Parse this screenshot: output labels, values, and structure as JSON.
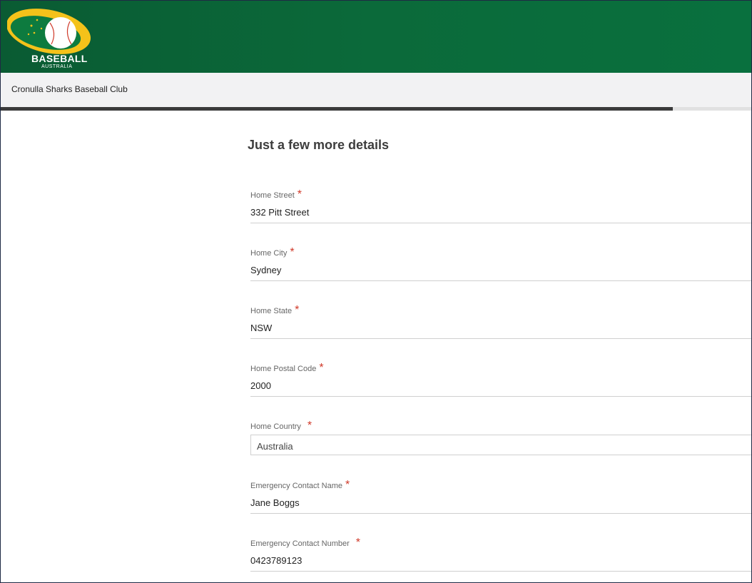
{
  "header": {
    "logo_text": "BASEBALL",
    "logo_subtext": "AUSTRALIA",
    "brand_colors": {
      "green": "#0b6a3a",
      "gold": "#f4c21a"
    }
  },
  "club": {
    "name": "Cronulla Sharks Baseball Club"
  },
  "progress": {
    "percent": 89.5
  },
  "form": {
    "title": "Just a few more details",
    "required_marker": "*",
    "fields": [
      {
        "label": "Home Street",
        "value": "332 Pitt Street",
        "type": "text"
      },
      {
        "label": "Home City",
        "value": "Sydney",
        "type": "text"
      },
      {
        "label": "Home State",
        "value": "NSW",
        "type": "text"
      },
      {
        "label": "Home Postal Code",
        "value": "2000",
        "type": "text"
      },
      {
        "label": "Home Country",
        "value": "Australia",
        "type": "select"
      },
      {
        "label": "Emergency Contact Name",
        "value": "Jane Boggs",
        "type": "text"
      },
      {
        "label": "Emergency Contact Number",
        "value": "0423789123",
        "type": "text"
      }
    ]
  }
}
